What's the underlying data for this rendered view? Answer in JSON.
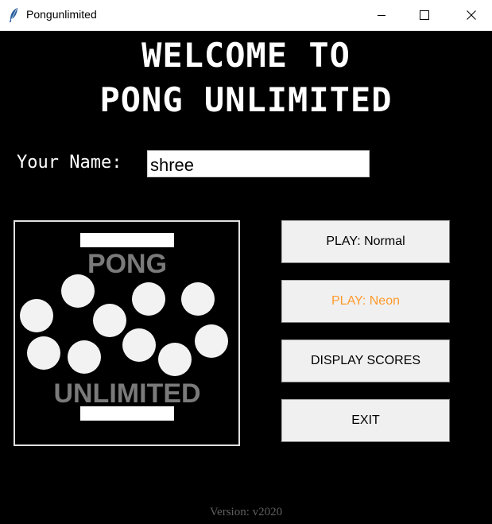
{
  "window": {
    "title": "Pongunlimited",
    "app_icon": "feather-icon",
    "controls": [
      "minimize-icon",
      "maximize-icon",
      "close-icon"
    ]
  },
  "heading": {
    "line1": "WELCOME TO",
    "line2": "PONG UNLIMITED"
  },
  "name_field": {
    "label": "Your Name:",
    "value": "shree"
  },
  "logo": {
    "top_text": "PONG",
    "bottom_text": "UNLIMITED"
  },
  "buttons": {
    "play_normal": "PLAY: Normal",
    "play_neon": "PLAY: Neon",
    "display_scores": "DISPLAY SCORES",
    "exit": "EXIT"
  },
  "colors": {
    "background": "#000000",
    "neon_text": "#ff9a2e",
    "version_text": "#5f5f5f"
  },
  "footer": {
    "version": "Version: v2020"
  }
}
